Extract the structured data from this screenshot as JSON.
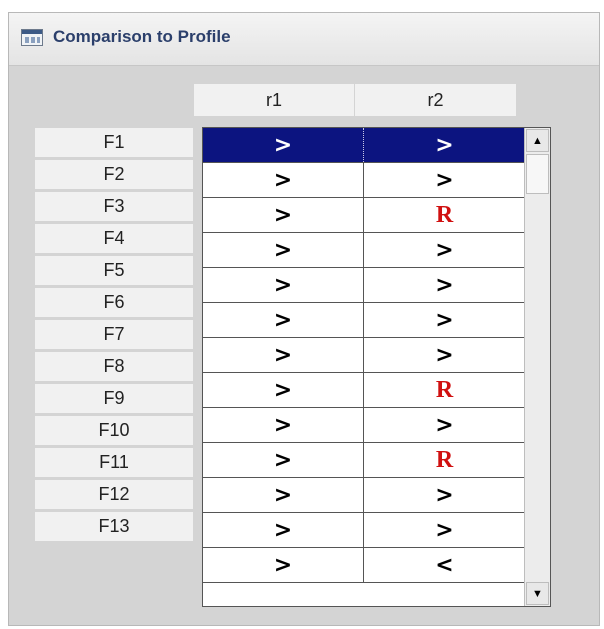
{
  "window": {
    "title": "Comparison to Profile",
    "title_icon": "table-window-icon"
  },
  "columns": [
    "r1",
    "r2"
  ],
  "rows": [
    {
      "label": "F1",
      "r1": ">",
      "r2": ">",
      "selected": true
    },
    {
      "label": "F2",
      "r1": ">",
      "r2": ">"
    },
    {
      "label": "F3",
      "r1": ">",
      "r2": "R"
    },
    {
      "label": "F4",
      "r1": ">",
      "r2": ">"
    },
    {
      "label": "F5",
      "r1": ">",
      "r2": ">"
    },
    {
      "label": "F6",
      "r1": ">",
      "r2": ">"
    },
    {
      "label": "F7",
      "r1": ">",
      "r2": ">"
    },
    {
      "label": "F8",
      "r1": ">",
      "r2": "R"
    },
    {
      "label": "F9",
      "r1": ">",
      "r2": ">"
    },
    {
      "label": "F10",
      "r1": ">",
      "r2": "R"
    },
    {
      "label": "F11",
      "r1": ">",
      "r2": ">"
    },
    {
      "label": "F12",
      "r1": ">",
      "r2": ">"
    },
    {
      "label": "F13",
      "r1": ">",
      "r2": "<"
    }
  ],
  "scrollbar": {
    "up_icon": "scroll-up-arrow-icon",
    "down_icon": "scroll-down-arrow-icon"
  },
  "colors": {
    "selection": "#0c1480",
    "r_marker": "#d01010",
    "title_text": "#2b3f6b"
  }
}
